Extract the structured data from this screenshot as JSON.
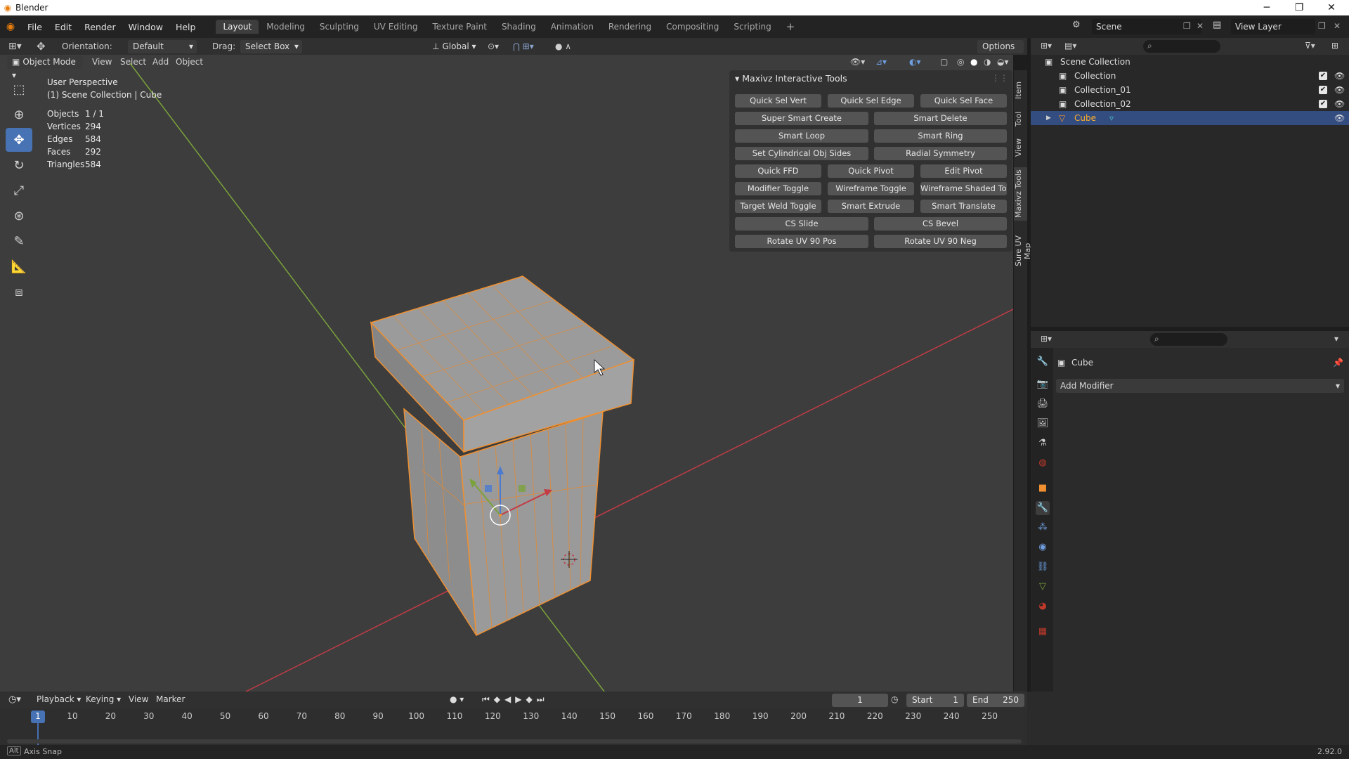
{
  "window": {
    "title": "Blender",
    "version": "2.92.0"
  },
  "menubar": {
    "menus": [
      "File",
      "Edit",
      "Render",
      "Window",
      "Help"
    ],
    "workspaces": [
      "Layout",
      "Modeling",
      "Sculpting",
      "UV Editing",
      "Texture Paint",
      "Shading",
      "Animation",
      "Rendering",
      "Compositing",
      "Scripting"
    ],
    "active_workspace": "Layout",
    "scene": "Scene",
    "view_layer": "View Layer"
  },
  "tool_header": {
    "orientation_label": "Orientation:",
    "orientation_value": "Default",
    "drag_label": "Drag:",
    "drag_value": "Select Box",
    "transform_orientation": "Global",
    "options_label": "Options"
  },
  "viewport_header": {
    "mode": "Object Mode",
    "menus": [
      "View",
      "Select",
      "Add",
      "Object"
    ]
  },
  "viewport": {
    "perspective": "User Perspective",
    "context": "(1) Scene Collection | Cube",
    "stats": [
      {
        "key": "Objects",
        "value": "1 / 1"
      },
      {
        "key": "Vertices",
        "value": "294"
      },
      {
        "key": "Edges",
        "value": "584"
      },
      {
        "key": "Faces",
        "value": "292"
      },
      {
        "key": "Triangles",
        "value": "584"
      }
    ]
  },
  "npanel": {
    "title": "Maxivz Interactive Tools",
    "tabs": [
      "Item",
      "Tool",
      "View",
      "Maxivz Tools",
      "Sure UV Map"
    ],
    "buttons": {
      "r1": [
        "Quick Sel Vert",
        "Quick Sel Edge",
        "Quick Sel Face"
      ],
      "r2": [
        "Super Smart Create",
        "Smart Delete"
      ],
      "r3": [
        "Smart Loop",
        "Smart Ring"
      ],
      "r4": [
        "Set Cylindrical Obj Sides",
        "Radial Symmetry"
      ],
      "r5": [
        "Quick FFD",
        "Quick Pivot",
        "Edit Pivot"
      ],
      "r6": [
        "Modifier Toggle",
        "Wireframe Toggle",
        "Wireframe Shaded Tog..."
      ],
      "r7": [
        "Target Weld Toggle",
        "Smart Extrude",
        "Smart Translate"
      ],
      "r8": [
        "CS Slide",
        "CS Bevel"
      ],
      "r9": [
        "Rotate UV 90 Pos",
        "Rotate UV 90 Neg"
      ]
    }
  },
  "outliner": {
    "items": [
      {
        "name": "Scene Collection"
      },
      {
        "name": "Collection"
      },
      {
        "name": "Collection_01"
      },
      {
        "name": "Collection_02"
      },
      {
        "name": "Cube"
      }
    ]
  },
  "properties": {
    "object_name": "Cube",
    "add_modifier": "Add Modifier"
  },
  "timeline": {
    "menus": [
      "Playback",
      "Keying",
      "View",
      "Marker"
    ],
    "current_frame": "1",
    "start_label": "Start",
    "start_value": "1",
    "end_label": "End",
    "end_value": "250",
    "ticks": [
      "1",
      "10",
      "20",
      "30",
      "40",
      "50",
      "60",
      "70",
      "80",
      "90",
      "100",
      "110",
      "120",
      "130",
      "140",
      "150",
      "160",
      "170",
      "180",
      "190",
      "200",
      "210",
      "220",
      "230",
      "240",
      "250"
    ]
  },
  "statusbar": {
    "hint": "Axis Snap"
  },
  "colors": {
    "accent": "#4772b3",
    "selection_orange": "#f09030",
    "active_object": "#ffaf29",
    "x_axis": "#c23b45",
    "y_axis": "#7aa23b"
  }
}
